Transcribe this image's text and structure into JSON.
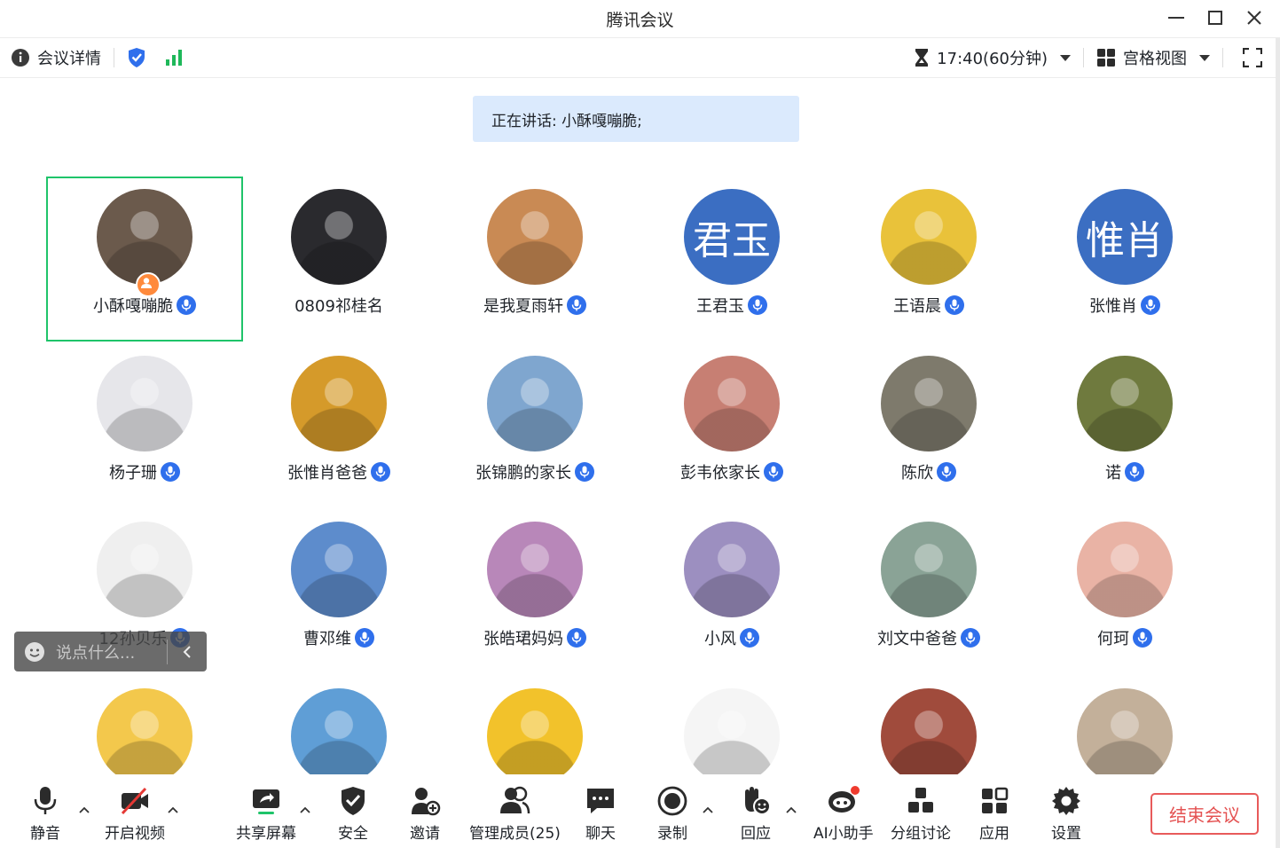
{
  "window": {
    "title": "腾讯会议"
  },
  "infobar": {
    "details_label": "会议详情",
    "timer": "17:40(60分钟)",
    "view_label": "宫格视图"
  },
  "speaking": {
    "text": "正在讲话: 小酥嘎嘣脆;"
  },
  "participants": [
    {
      "name": "小酥嘎嘣脆",
      "avatar": "photo",
      "color": "#6b5a4c",
      "host": true,
      "active": true,
      "mic": true
    },
    {
      "name": "0809祁桂名",
      "avatar": "photo",
      "color": "#2a2a2e",
      "mic": false
    },
    {
      "name": "是我夏雨轩",
      "avatar": "photo",
      "color": "#c98a54",
      "mic": true
    },
    {
      "name": "王君玉",
      "avatar": "text",
      "avatar_text": "君玉",
      "color": "#3b6ec2",
      "mic": true
    },
    {
      "name": "王语晨",
      "avatar": "photo",
      "color": "#e9c23a",
      "mic": true
    },
    {
      "name": "张惟肖",
      "avatar": "text",
      "avatar_text": "惟肖",
      "color": "#3b6ec2",
      "mic": true
    },
    {
      "name": "杨子珊",
      "avatar": "photo",
      "color": "#e6e6ea",
      "mic": true
    },
    {
      "name": "张惟肖爸爸",
      "avatar": "photo",
      "color": "#d59a2a",
      "mic": true
    },
    {
      "name": "张锦鹏的家长",
      "avatar": "photo",
      "color": "#7fa6cf",
      "mic": true
    },
    {
      "name": "彭韦依家长",
      "avatar": "photo",
      "color": "#c77f73",
      "mic": true
    },
    {
      "name": "陈欣",
      "avatar": "photo",
      "color": "#7e7a6c",
      "mic": true
    },
    {
      "name": "诺",
      "avatar": "photo",
      "color": "#6f7a3e",
      "mic": true
    },
    {
      "name": "12孙贝乐",
      "avatar": "photo",
      "color": "#efefef",
      "mic": true
    },
    {
      "name": "曹邓维",
      "avatar": "photo",
      "color": "#5d8ccc",
      "mic": true
    },
    {
      "name": "张皓珺妈妈",
      "avatar": "photo",
      "color": "#b887b9",
      "mic": true
    },
    {
      "name": "小风",
      "avatar": "photo",
      "color": "#9c8fc0",
      "mic": true
    },
    {
      "name": "刘文中爸爸",
      "avatar": "photo",
      "color": "#8aa396",
      "mic": true
    },
    {
      "name": "何珂",
      "avatar": "photo",
      "color": "#e9b3a5",
      "mic": true
    },
    {
      "name": "",
      "avatar": "photo",
      "color": "#f3c84c"
    },
    {
      "name": "",
      "avatar": "photo",
      "color": "#5f9ed6"
    },
    {
      "name": "",
      "avatar": "photo",
      "color": "#f2c22b"
    },
    {
      "name": "",
      "avatar": "photo",
      "color": "#f5f5f5"
    },
    {
      "name": "",
      "avatar": "photo",
      "color": "#a04b3c"
    },
    {
      "name": "",
      "avatar": "photo",
      "color": "#c3b09a"
    }
  ],
  "chat": {
    "placeholder": "说点什么..."
  },
  "toolbar": {
    "mute": "静音",
    "video": "开启视频",
    "share": "共享屏幕",
    "security": "安全",
    "invite": "邀请",
    "members": "管理成员(25)",
    "chat": "聊天",
    "record": "录制",
    "react": "回应",
    "ai": "AI小助手",
    "breakout": "分组讨论",
    "apps": "应用",
    "settings": "设置",
    "end": "结束会议"
  },
  "colors": {
    "accent": "#2f6fec",
    "active_border": "#1fc46a",
    "end_red": "#e45252",
    "banner_bg": "#dbeafd"
  }
}
